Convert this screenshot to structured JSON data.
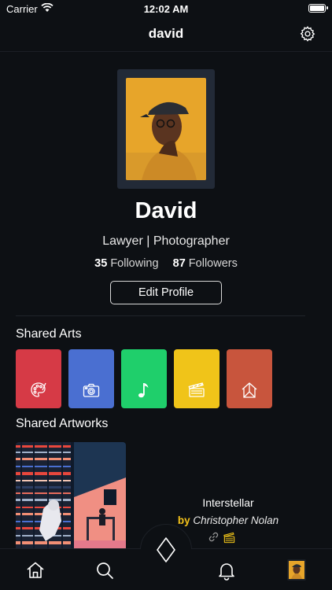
{
  "status_bar": {
    "carrier": "Carrier",
    "time": "12:02 AM"
  },
  "nav": {
    "title": "david"
  },
  "profile": {
    "name": "David",
    "bio": "Lawyer | Photographer",
    "following_count": "35",
    "following_label": "Following",
    "followers_count": "87",
    "followers_label": "Followers",
    "edit_button": "Edit Profile"
  },
  "shared_arts": {
    "title": "Shared Arts",
    "tiles": [
      {
        "icon": "palette-icon",
        "color": "#d63a46"
      },
      {
        "icon": "camera-icon",
        "color": "#4a6fd1"
      },
      {
        "icon": "music-note-icon",
        "color": "#1fcf6b"
      },
      {
        "icon": "clapperboard-icon",
        "color": "#f0c419"
      },
      {
        "icon": "house-outline-icon",
        "color": "#c8553d"
      }
    ]
  },
  "shared_artworks": {
    "title": "Shared Artworks",
    "items": [
      {
        "name": "Interstellar",
        "by": "by",
        "author": "Christopher Nolan"
      }
    ]
  },
  "tab_bar": {
    "items": [
      "home-icon",
      "search-icon",
      "diamond-icon",
      "bell-icon",
      "profile-avatar"
    ]
  },
  "colors": {
    "background": "#0d1014",
    "accent": "#f4c21a"
  }
}
